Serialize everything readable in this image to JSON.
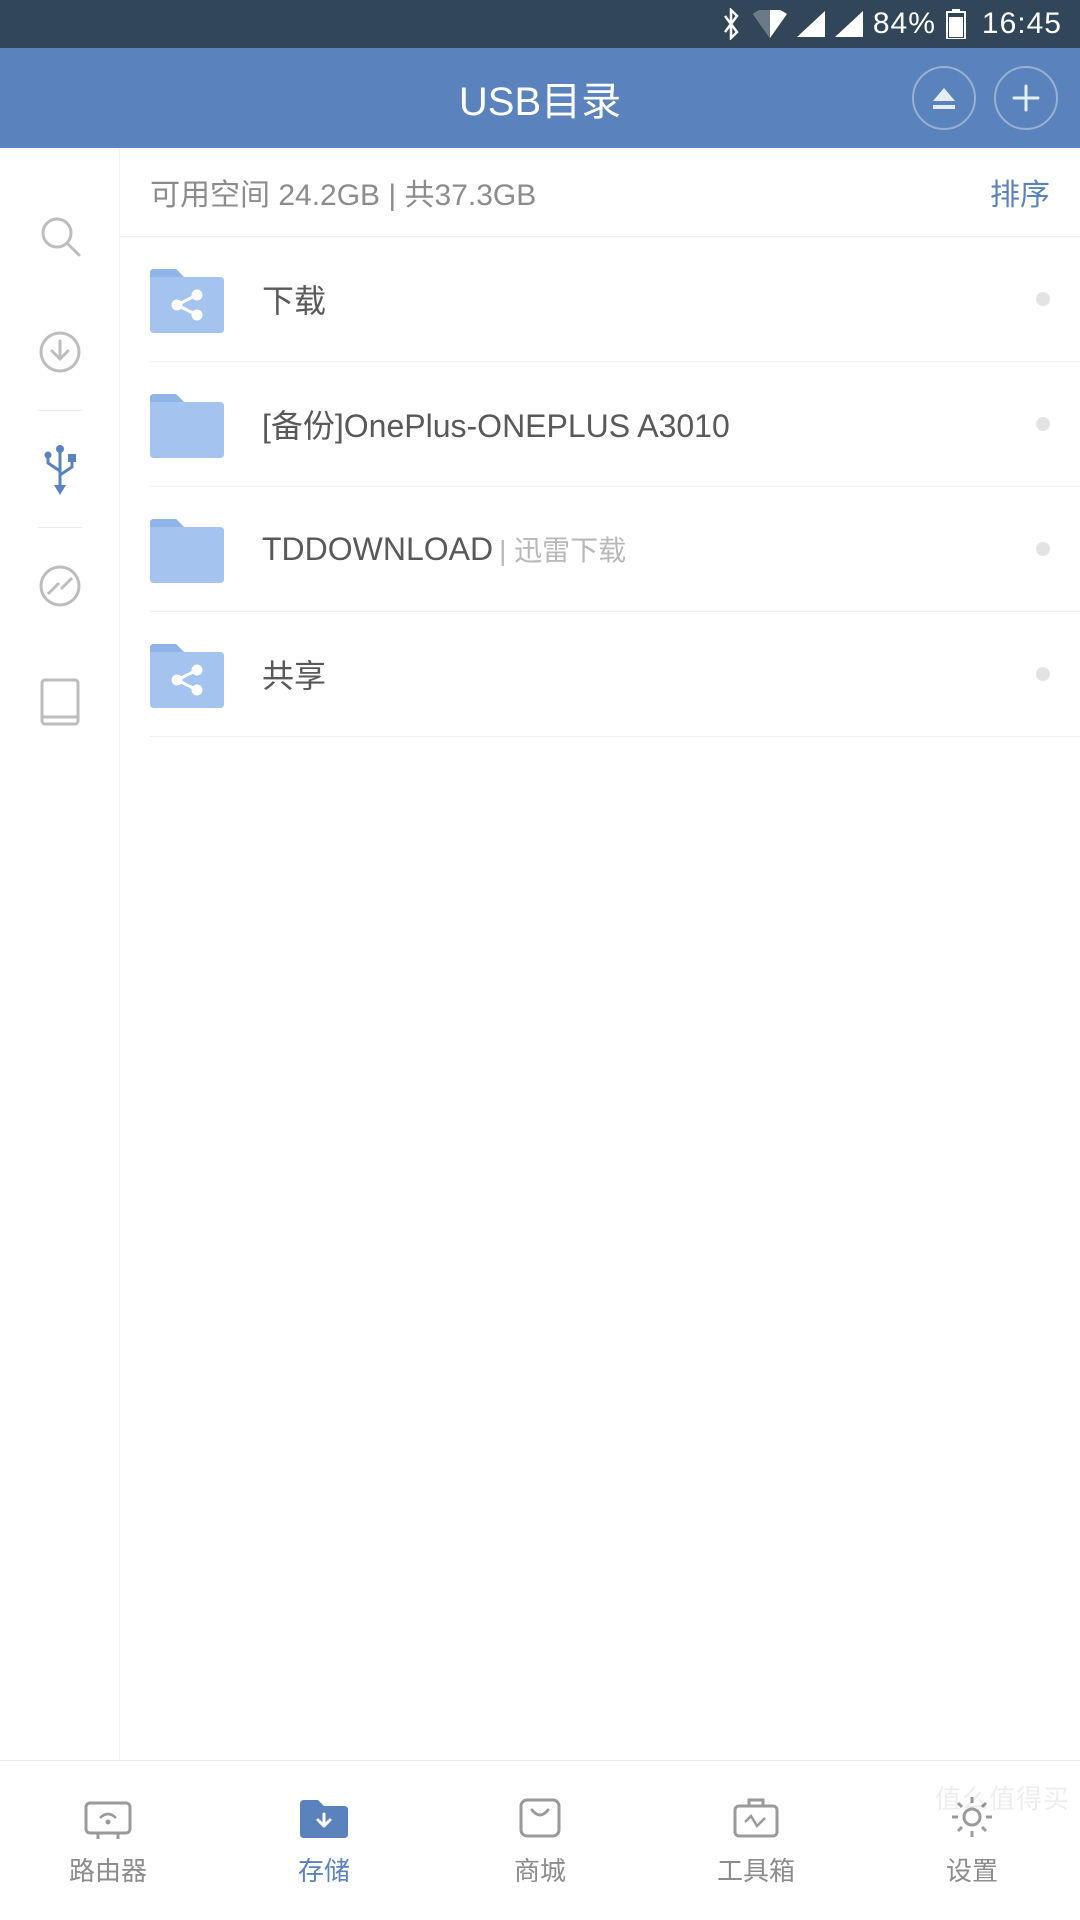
{
  "status_bar": {
    "battery_percent": "84%",
    "time": "16:45"
  },
  "header": {
    "title": "USB目录"
  },
  "sidebar": {
    "items": [
      {
        "key": "search"
      },
      {
        "key": "download"
      },
      {
        "key": "usb"
      },
      {
        "key": "blocked"
      },
      {
        "key": "tablet"
      }
    ]
  },
  "storage": {
    "text": "可用空间 24.2GB | 共37.3GB",
    "sort_label": "排序"
  },
  "folders": [
    {
      "name": "下载",
      "sub": "",
      "share": true
    },
    {
      "name": "[备份]OnePlus-ONEPLUS A3010",
      "sub": "",
      "share": false
    },
    {
      "name": "TDDOWNLOAD",
      "sub": "| 迅雷下载",
      "share": false
    },
    {
      "name": "共享",
      "sub": "",
      "share": true
    }
  ],
  "bottom_nav": {
    "items": [
      {
        "label": "路由器"
      },
      {
        "label": "存储"
      },
      {
        "label": "商城"
      },
      {
        "label": "工具箱"
      },
      {
        "label": "设置"
      }
    ]
  },
  "watermark": "值么值得买"
}
